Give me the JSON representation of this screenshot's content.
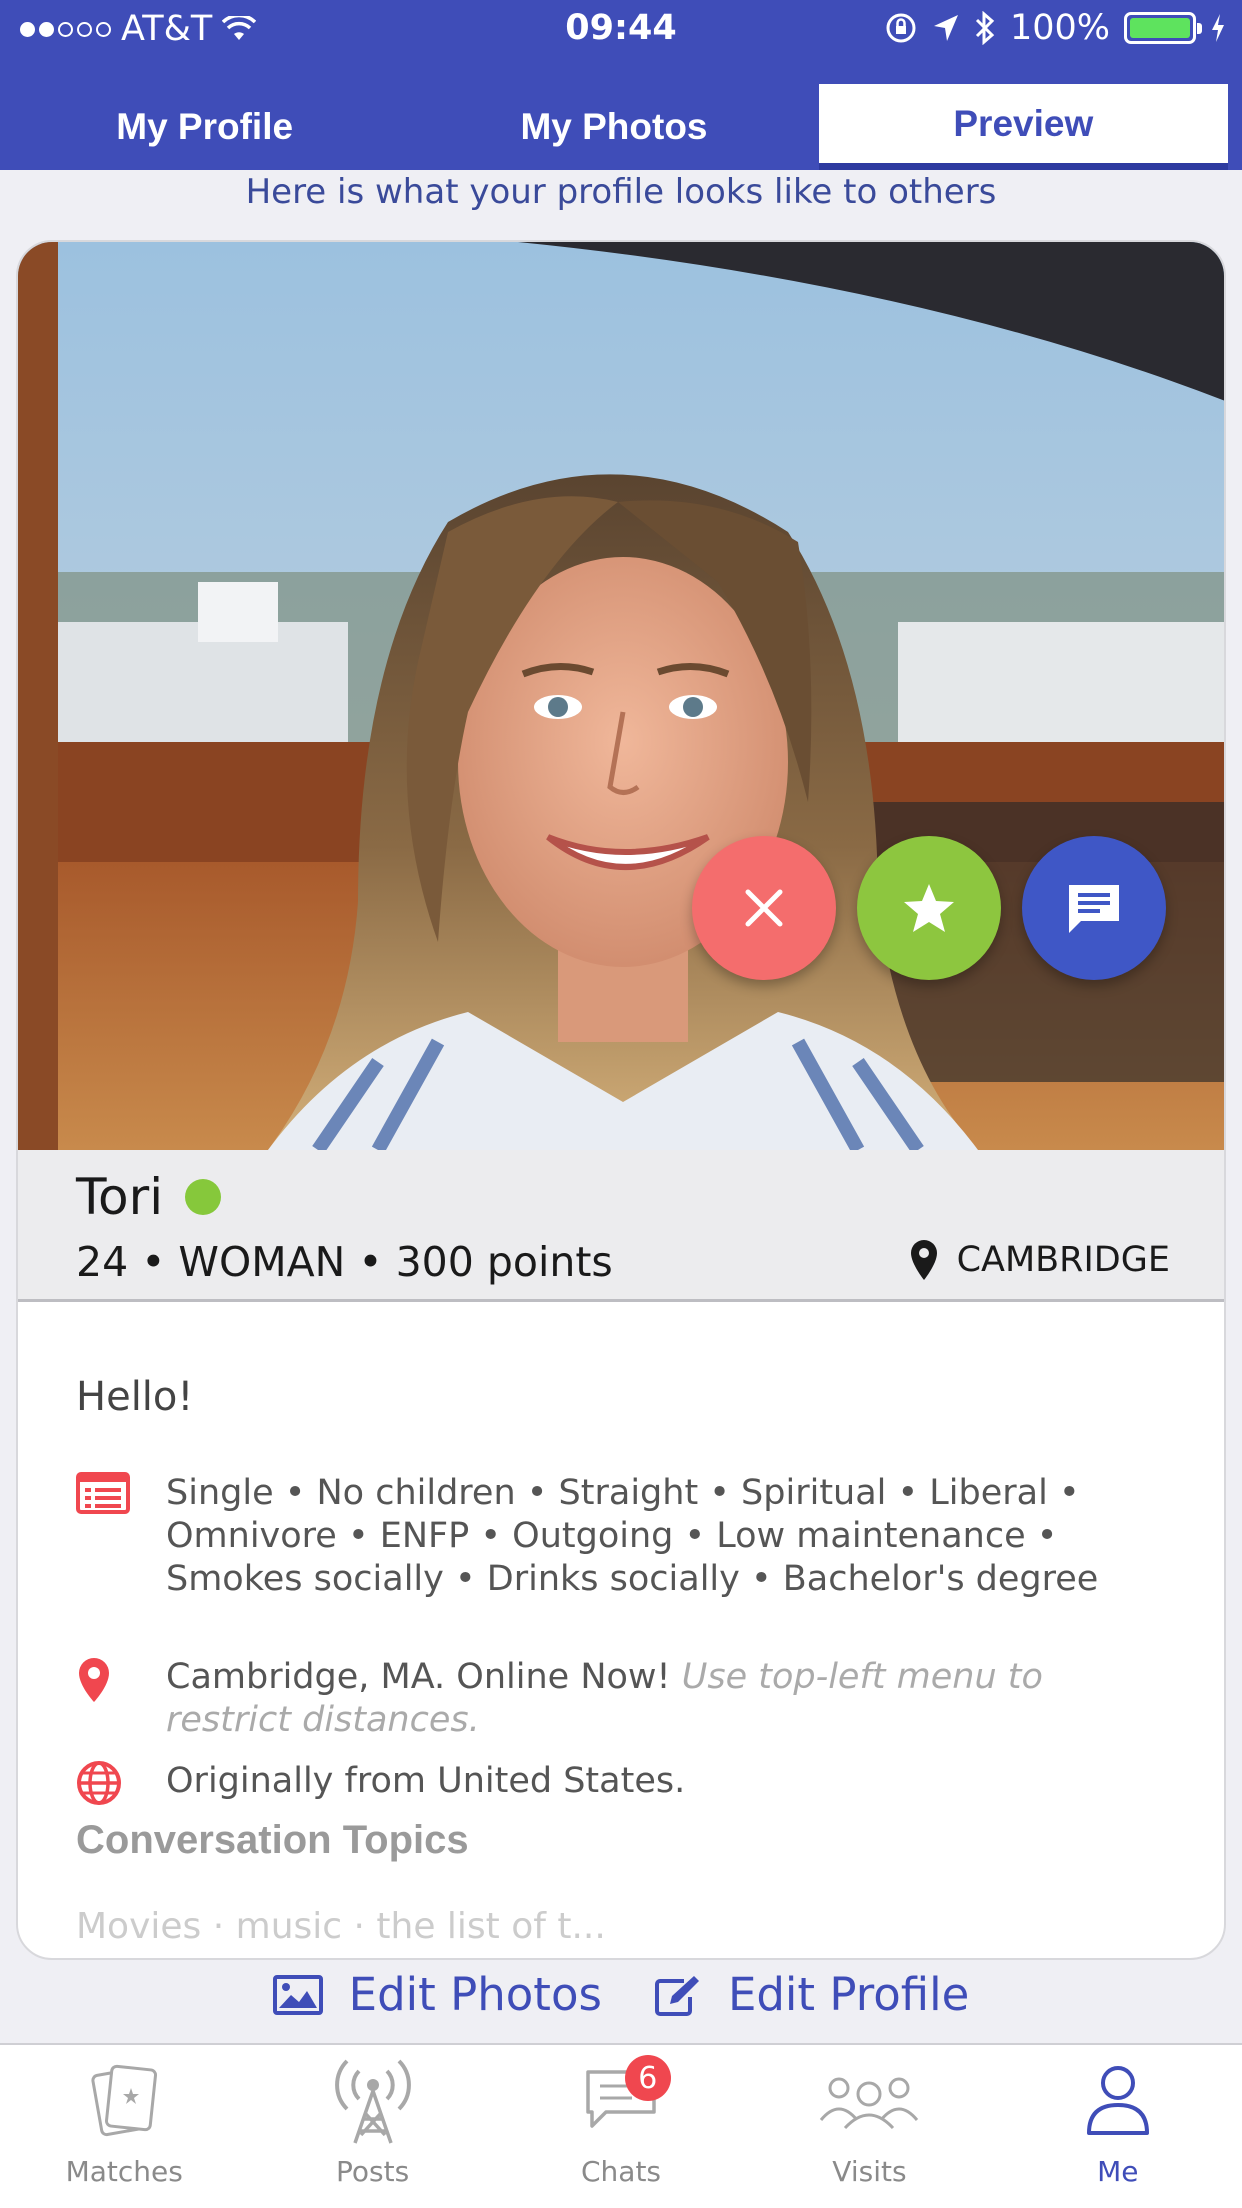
{
  "status_bar": {
    "carrier": "AT&T",
    "time": "09:44",
    "battery": "100%"
  },
  "tabs": [
    {
      "label": "My Profile",
      "active": false
    },
    {
      "label": "My Photos",
      "active": false
    },
    {
      "label": "Preview",
      "active": true
    }
  ],
  "subtitle": "Here is what your profile looks like to others",
  "profile": {
    "name": "Tori",
    "meta": "24 • WOMAN • 300 points",
    "location": "CAMBRIDGE",
    "greeting": "Hello!",
    "details": "Single • No children • Straight • Spiritual • Liberal • Omnivore • ENFP • Outgoing • Low maintenance • Smokes socially • Drinks socially • Bachelor's degree",
    "location_line": "Cambridge, MA. Online Now!",
    "location_hint": "Use top-left menu to restrict distances.",
    "origin": "Originally from United States.",
    "topics_heading": "Conversation Topics",
    "topics_fade": "Movies · music · the list of t..."
  },
  "actions": {
    "edit_photos": "Edit Photos",
    "edit_profile": "Edit Profile"
  },
  "nav": [
    {
      "label": "Matches",
      "icon": "cards-icon"
    },
    {
      "label": "Posts",
      "icon": "broadcast-tower-icon"
    },
    {
      "label": "Chats",
      "icon": "chat-bubble-icon",
      "badge": "6"
    },
    {
      "label": "Visits",
      "icon": "people-icon"
    },
    {
      "label": "Me",
      "icon": "person-icon",
      "active": true
    }
  ],
  "colors": {
    "brand": "#3f4db8",
    "pass": "#f46d6d",
    "favorite": "#8dc63f",
    "message": "#3f57c6",
    "online": "#86c83b",
    "accent_red": "#f0474f"
  }
}
